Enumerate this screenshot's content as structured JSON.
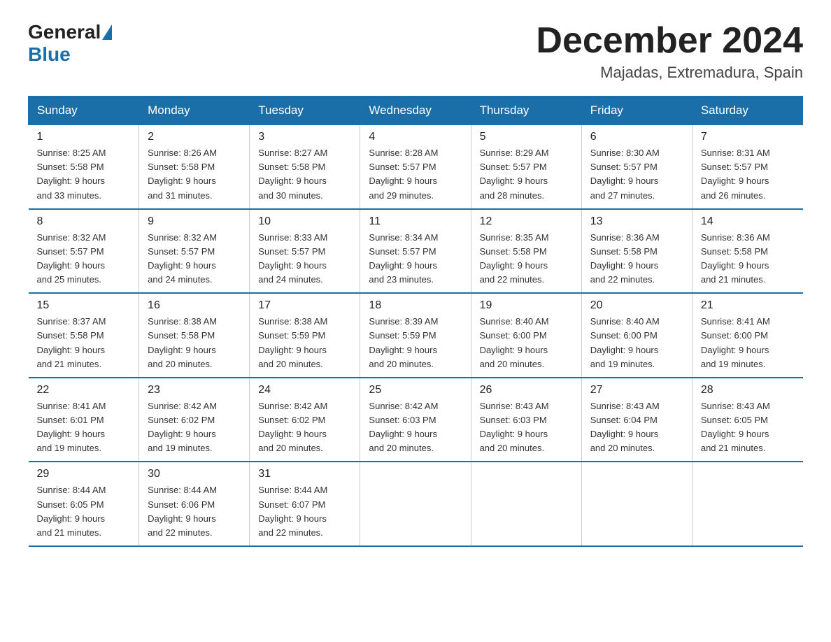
{
  "header": {
    "logo_general": "General",
    "logo_blue": "Blue",
    "month_title": "December 2024",
    "location": "Majadas, Extremadura, Spain"
  },
  "days_of_week": [
    "Sunday",
    "Monday",
    "Tuesday",
    "Wednesday",
    "Thursday",
    "Friday",
    "Saturday"
  ],
  "weeks": [
    [
      {
        "num": "1",
        "sunrise": "8:25 AM",
        "sunset": "5:58 PM",
        "daylight": "9 hours and 33 minutes."
      },
      {
        "num": "2",
        "sunrise": "8:26 AM",
        "sunset": "5:58 PM",
        "daylight": "9 hours and 31 minutes."
      },
      {
        "num": "3",
        "sunrise": "8:27 AM",
        "sunset": "5:58 PM",
        "daylight": "9 hours and 30 minutes."
      },
      {
        "num": "4",
        "sunrise": "8:28 AM",
        "sunset": "5:57 PM",
        "daylight": "9 hours and 29 minutes."
      },
      {
        "num": "5",
        "sunrise": "8:29 AM",
        "sunset": "5:57 PM",
        "daylight": "9 hours and 28 minutes."
      },
      {
        "num": "6",
        "sunrise": "8:30 AM",
        "sunset": "5:57 PM",
        "daylight": "9 hours and 27 minutes."
      },
      {
        "num": "7",
        "sunrise": "8:31 AM",
        "sunset": "5:57 PM",
        "daylight": "9 hours and 26 minutes."
      }
    ],
    [
      {
        "num": "8",
        "sunrise": "8:32 AM",
        "sunset": "5:57 PM",
        "daylight": "9 hours and 25 minutes."
      },
      {
        "num": "9",
        "sunrise": "8:32 AM",
        "sunset": "5:57 PM",
        "daylight": "9 hours and 24 minutes."
      },
      {
        "num": "10",
        "sunrise": "8:33 AM",
        "sunset": "5:57 PM",
        "daylight": "9 hours and 24 minutes."
      },
      {
        "num": "11",
        "sunrise": "8:34 AM",
        "sunset": "5:57 PM",
        "daylight": "9 hours and 23 minutes."
      },
      {
        "num": "12",
        "sunrise": "8:35 AM",
        "sunset": "5:58 PM",
        "daylight": "9 hours and 22 minutes."
      },
      {
        "num": "13",
        "sunrise": "8:36 AM",
        "sunset": "5:58 PM",
        "daylight": "9 hours and 22 minutes."
      },
      {
        "num": "14",
        "sunrise": "8:36 AM",
        "sunset": "5:58 PM",
        "daylight": "9 hours and 21 minutes."
      }
    ],
    [
      {
        "num": "15",
        "sunrise": "8:37 AM",
        "sunset": "5:58 PM",
        "daylight": "9 hours and 21 minutes."
      },
      {
        "num": "16",
        "sunrise": "8:38 AM",
        "sunset": "5:58 PM",
        "daylight": "9 hours and 20 minutes."
      },
      {
        "num": "17",
        "sunrise": "8:38 AM",
        "sunset": "5:59 PM",
        "daylight": "9 hours and 20 minutes."
      },
      {
        "num": "18",
        "sunrise": "8:39 AM",
        "sunset": "5:59 PM",
        "daylight": "9 hours and 20 minutes."
      },
      {
        "num": "19",
        "sunrise": "8:40 AM",
        "sunset": "6:00 PM",
        "daylight": "9 hours and 20 minutes."
      },
      {
        "num": "20",
        "sunrise": "8:40 AM",
        "sunset": "6:00 PM",
        "daylight": "9 hours and 19 minutes."
      },
      {
        "num": "21",
        "sunrise": "8:41 AM",
        "sunset": "6:00 PM",
        "daylight": "9 hours and 19 minutes."
      }
    ],
    [
      {
        "num": "22",
        "sunrise": "8:41 AM",
        "sunset": "6:01 PM",
        "daylight": "9 hours and 19 minutes."
      },
      {
        "num": "23",
        "sunrise": "8:42 AM",
        "sunset": "6:02 PM",
        "daylight": "9 hours and 19 minutes."
      },
      {
        "num": "24",
        "sunrise": "8:42 AM",
        "sunset": "6:02 PM",
        "daylight": "9 hours and 20 minutes."
      },
      {
        "num": "25",
        "sunrise": "8:42 AM",
        "sunset": "6:03 PM",
        "daylight": "9 hours and 20 minutes."
      },
      {
        "num": "26",
        "sunrise": "8:43 AM",
        "sunset": "6:03 PM",
        "daylight": "9 hours and 20 minutes."
      },
      {
        "num": "27",
        "sunrise": "8:43 AM",
        "sunset": "6:04 PM",
        "daylight": "9 hours and 20 minutes."
      },
      {
        "num": "28",
        "sunrise": "8:43 AM",
        "sunset": "6:05 PM",
        "daylight": "9 hours and 21 minutes."
      }
    ],
    [
      {
        "num": "29",
        "sunrise": "8:44 AM",
        "sunset": "6:05 PM",
        "daylight": "9 hours and 21 minutes."
      },
      {
        "num": "30",
        "sunrise": "8:44 AM",
        "sunset": "6:06 PM",
        "daylight": "9 hours and 22 minutes."
      },
      {
        "num": "31",
        "sunrise": "8:44 AM",
        "sunset": "6:07 PM",
        "daylight": "9 hours and 22 minutes."
      },
      null,
      null,
      null,
      null
    ]
  ],
  "labels": {
    "sunrise": "Sunrise: ",
    "sunset": "Sunset: ",
    "daylight": "Daylight: "
  }
}
